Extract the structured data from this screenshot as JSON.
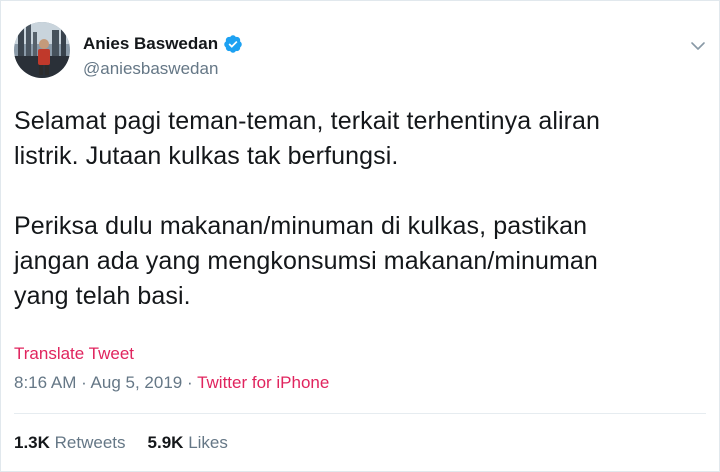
{
  "author": {
    "name": "Anies Baswedan",
    "handle": "@aniesbaswedan",
    "verified": true
  },
  "tweet": {
    "line1": "Selamat pagi teman-teman, terkait terhentinya aliran",
    "line2": "listrik. Jutaan kulkas tak berfungsi.",
    "line3": "Periksa dulu makanan/minuman di kulkas, pastikan",
    "line4": "jangan ada yang mengkonsumsi makanan/minuman",
    "line5": "yang telah basi."
  },
  "translate_label": "Translate Tweet",
  "meta": {
    "time": "8:16 AM",
    "separator": " · ",
    "date": "Aug 5, 2019",
    "source": "Twitter for iPhone"
  },
  "stats": {
    "retweets_count": "1.3K",
    "retweets_label": "Retweets",
    "likes_count": "5.9K",
    "likes_label": "Likes"
  },
  "colors": {
    "accent": "#e0245e",
    "secondary_text": "#657786",
    "verified_blue": "#1da1f2"
  },
  "icons": {
    "verified": "verified-badge-icon",
    "caret": "chevron-down-icon"
  }
}
